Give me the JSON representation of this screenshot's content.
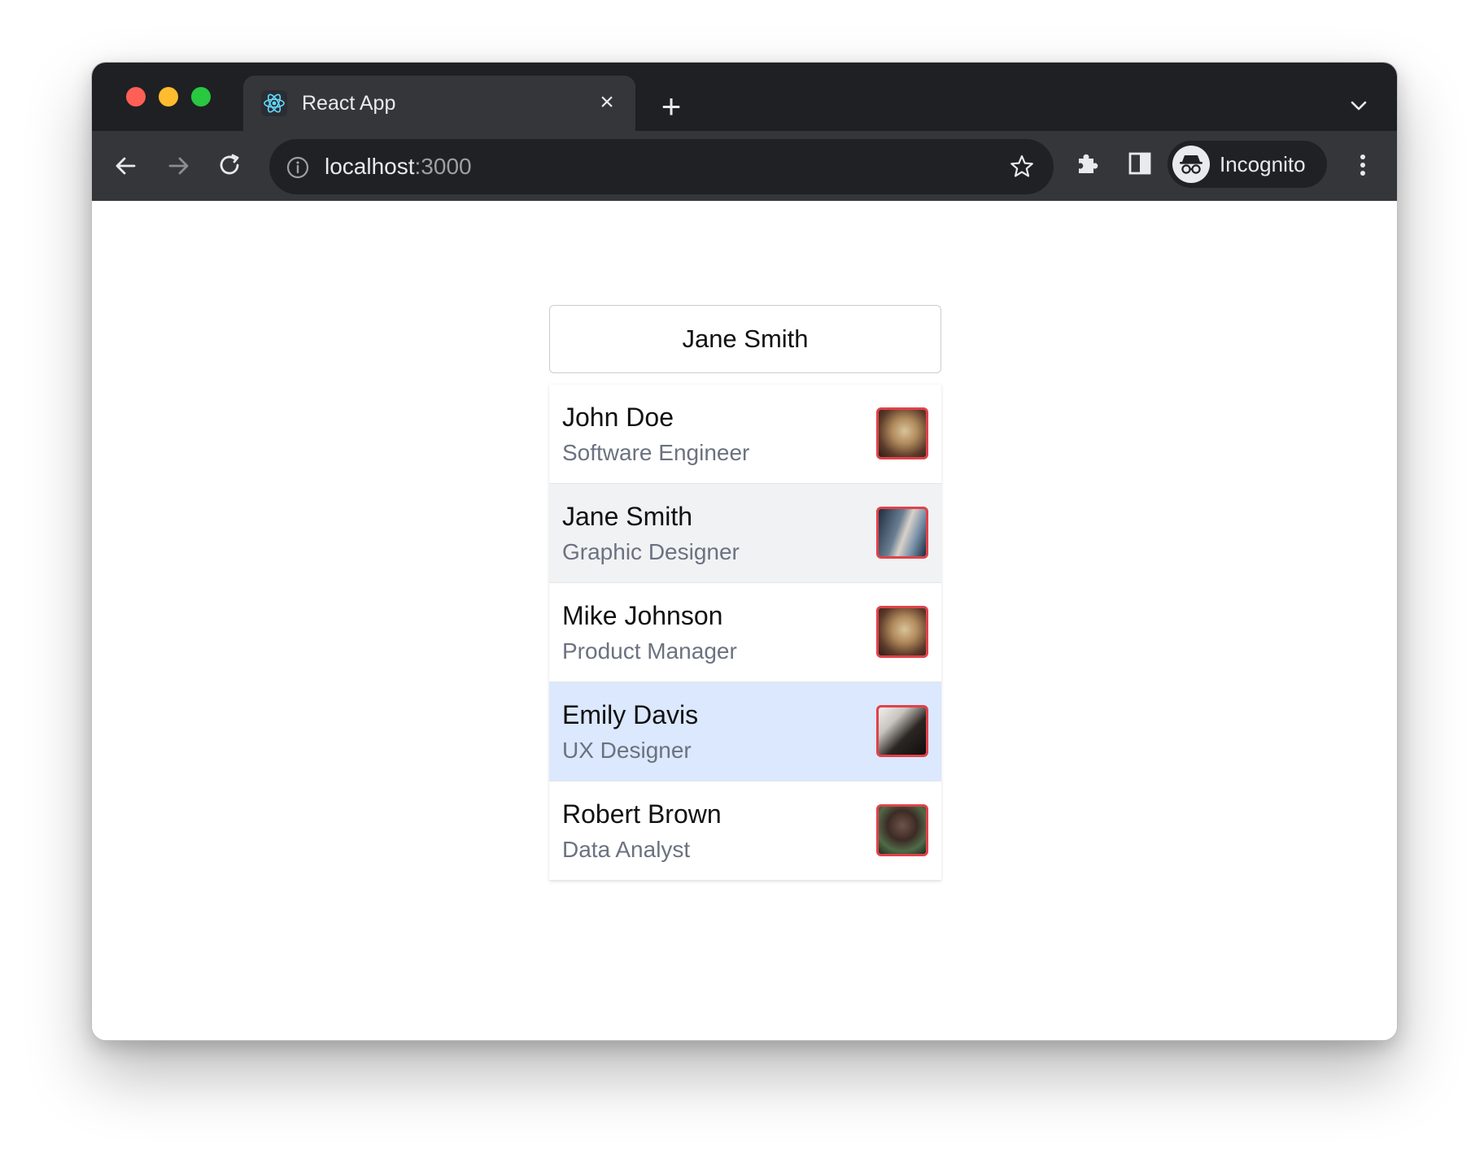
{
  "browser": {
    "tab_title": "React App",
    "tab_close": "×",
    "new_tab": "+",
    "url_host": "localhost",
    "url_port": ":3000",
    "profile_label": "Incognito"
  },
  "app": {
    "selected_value": "Jane Smith",
    "people": [
      {
        "name": "John Doe",
        "role": "Software Engineer",
        "avatar": "avatar-photo-1"
      },
      {
        "name": "Jane Smith",
        "role": "Graphic Designer",
        "avatar": "avatar-photo-2"
      },
      {
        "name": "Mike Johnson",
        "role": "Product Manager",
        "avatar": "avatar-photo-1"
      },
      {
        "name": "Emily Davis",
        "role": "UX Designer",
        "avatar": "avatar-photo-3"
      },
      {
        "name": "Robert Brown",
        "role": "Data Analyst",
        "avatar": "avatar-photo-4"
      }
    ],
    "hovered_index": 1,
    "active_index": 3
  },
  "colors": {
    "chrome_dark": "#1f2023",
    "toolbar": "#35363a",
    "hover_row": "#f1f2f4",
    "active_row": "#dbe8fd",
    "avatar_border": "#e0424a",
    "secondary_text": "#6b7280"
  }
}
